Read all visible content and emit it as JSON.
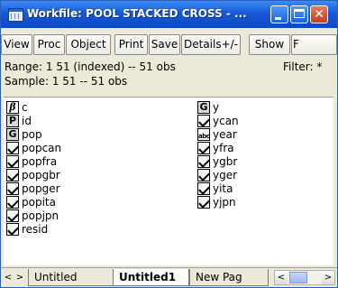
{
  "window": {
    "title": "Workfile: POOL STACKED CROSS - ...",
    "close_glyph": "✕"
  },
  "toolbar": {
    "view": "View",
    "proc": "Proc",
    "object": "Object",
    "print": "Print",
    "save": "Save",
    "details": "Details+/-",
    "show": "Show",
    "fetch": "F"
  },
  "info": {
    "range": "Range:  1 51 (indexed)  --  51 obs",
    "sample": "Sample: 1 51  --  51 obs",
    "filter": "Filter: *"
  },
  "objects": {
    "left": [
      {
        "name": "c",
        "icon": "coef-icon"
      },
      {
        "name": "id",
        "icon": "pool-icon"
      },
      {
        "name": "pop",
        "icon": "group-icon"
      },
      {
        "name": "popcan",
        "icon": "series-icon"
      },
      {
        "name": "popfra",
        "icon": "series-icon"
      },
      {
        "name": "popgbr",
        "icon": "series-icon"
      },
      {
        "name": "popger",
        "icon": "series-icon"
      },
      {
        "name": "popita",
        "icon": "series-icon"
      },
      {
        "name": "popjpn",
        "icon": "series-icon"
      },
      {
        "name": "resid",
        "icon": "series-icon"
      }
    ],
    "right": [
      {
        "name": "y",
        "icon": "group-icon"
      },
      {
        "name": "ycan",
        "icon": "series-icon"
      },
      {
        "name": "year",
        "icon": "alpha-icon"
      },
      {
        "name": "yfra",
        "icon": "series-icon"
      },
      {
        "name": "ygbr",
        "icon": "series-icon"
      },
      {
        "name": "yger",
        "icon": "series-icon"
      },
      {
        "name": "yita",
        "icon": "series-icon"
      },
      {
        "name": "yjpn",
        "icon": "series-icon"
      }
    ]
  },
  "tabs": {
    "prev": "<",
    "next": ">",
    "items": [
      "Untitled",
      "Untitled1",
      "New Pag"
    ],
    "active": "Untitled1"
  },
  "hscroll": {
    "left": "<",
    "right": ">"
  }
}
